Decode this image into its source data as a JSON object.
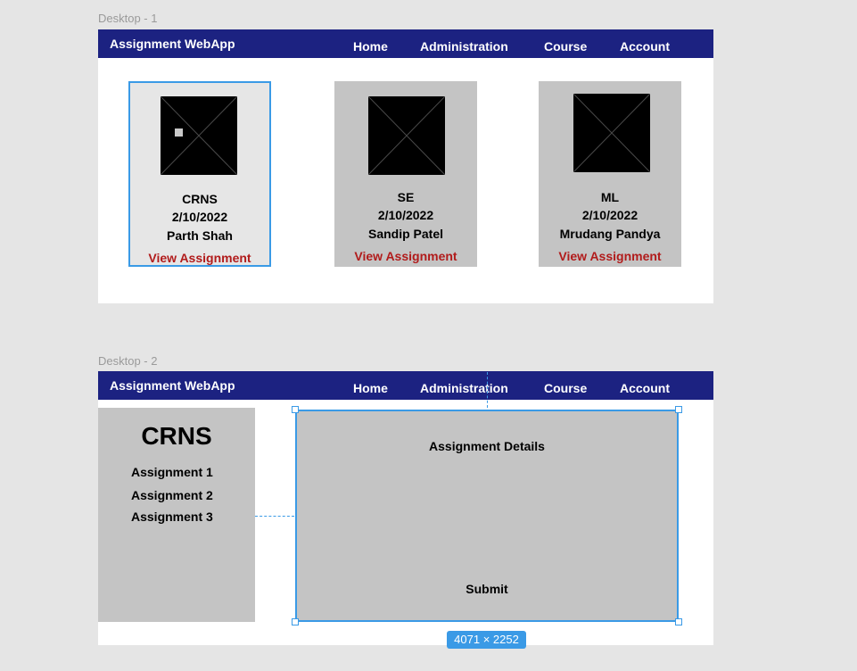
{
  "frames": {
    "desktop1_label": "Desktop - 1",
    "desktop2_label": "Desktop - 2"
  },
  "navbar": {
    "brand": "Assignment WebApp",
    "items": [
      "Home",
      "Administration",
      "Course",
      "Account"
    ]
  },
  "cards": [
    {
      "course": "CRNS",
      "date": "2/10/2022",
      "teacher": "Parth Shah",
      "link": "View Assignment"
    },
    {
      "course": "SE",
      "date": "2/10/2022",
      "teacher": "Sandip Patel",
      "link": "View Assignment"
    },
    {
      "course": "ML",
      "date": "2/10/2022",
      "teacher": "Mrudang Pandya",
      "link": "View Assignment"
    }
  ],
  "course_page": {
    "title": "CRNS",
    "assignments": [
      "Assignment 1",
      "Assignment 2",
      "Assignment 3"
    ],
    "details_title": "Assignment Details",
    "submit_label": "Submit"
  },
  "selection_dimensions": "4071 × 2252",
  "colors": {
    "navbar": "#1c2281",
    "link": "#b11b1b",
    "selection": "#3a9ae6",
    "panel": "#c4c4c4"
  }
}
